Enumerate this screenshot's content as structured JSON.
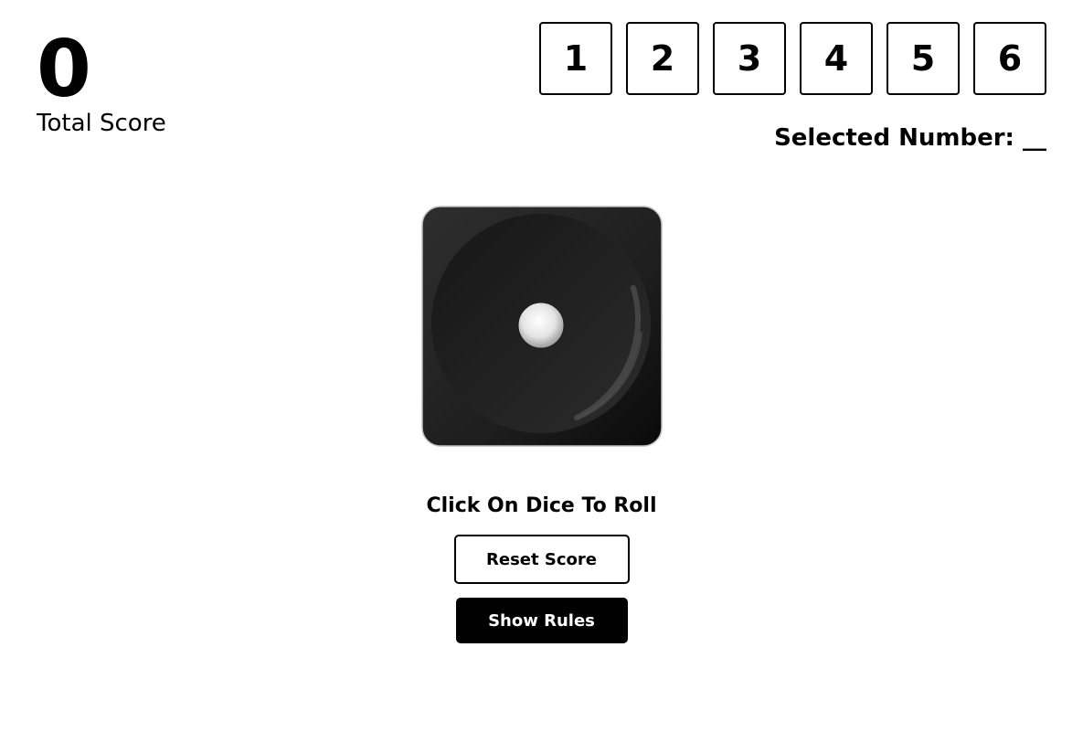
{
  "score": {
    "value": "0",
    "label": "Total Score"
  },
  "number_selector": {
    "numbers": [
      "1",
      "2",
      "3",
      "4",
      "5",
      "6"
    ],
    "selected_label": "Selected Number:",
    "selected_value": "__"
  },
  "dice": {
    "face": 1,
    "icon": "dice-face-one-icon"
  },
  "roll_hint": "Click On Dice To Roll",
  "buttons": {
    "reset": "Reset Score",
    "rules": "Show Rules"
  },
  "colors": {
    "accent": "#000000",
    "background": "#ffffff",
    "dice_body": "#1c1c1c",
    "pip": "#e6e6e6"
  }
}
